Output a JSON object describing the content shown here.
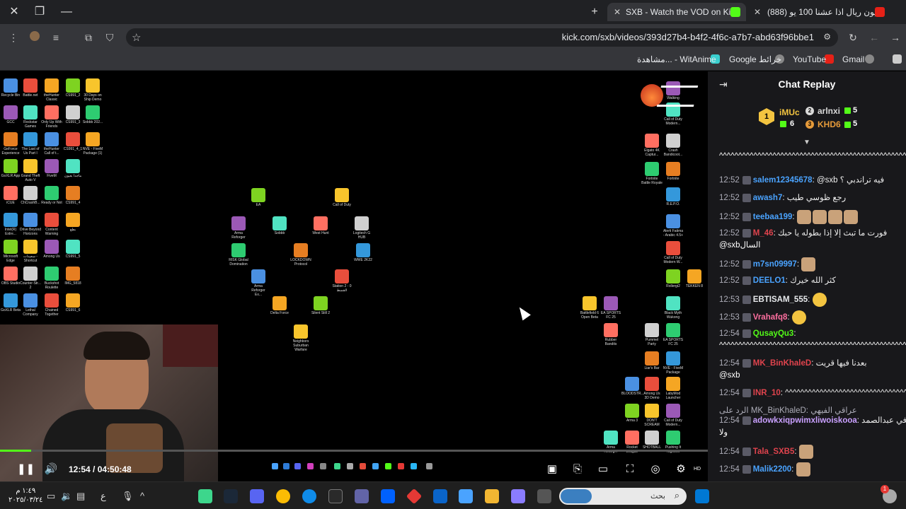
{
  "browser": {
    "tabs": [
      {
        "title": "SXB - Watch the VOD on Kick",
        "active": true
      },
      {
        "title": "(888) مليون ريال اذا عشنا 100 يو",
        "active": false
      }
    ],
    "url": "kick.com/sxb/videos/393d27b4-b4f2-4f6c-a7b7-abd63f96bbe1",
    "bookmarks": [
      {
        "label": "Gmail"
      },
      {
        "label": "YouTube"
      },
      {
        "label": "Google خرائط"
      },
      {
        "label": "مشاهدة... - WitAnime"
      }
    ]
  },
  "player": {
    "time_display": "12:54 / 04:50:48",
    "progress_fraction": 0.044
  },
  "desktop_icons": [
    {
      "label": "Recycle Bin"
    },
    {
      "label": "Battle.net"
    },
    {
      "label": "theHunter Classic"
    },
    {
      "label": "CS991_2"
    },
    {
      "label": "30 Days on Ship Demo"
    },
    {
      "label": "GCC"
    },
    {
      "label": "Rockstar Games"
    },
    {
      "label": "Only Up With Friends"
    },
    {
      "label": "CS991_3"
    },
    {
      "label": "Sobbb 202..."
    },
    {
      "label": "GeForce Experience"
    },
    {
      "label": "The Last of Us Part I"
    },
    {
      "label": "theHunter Call of t..."
    },
    {
      "label": "CS991_4_1"
    },
    {
      "label": "NVE - FiveM Package (1)"
    },
    {
      "label": "GoXLR App"
    },
    {
      "label": "Grand Theft Auto V"
    },
    {
      "label": "FiveM"
    },
    {
      "label": "ماجدا بعيون"
    },
    {
      "label": "iCUE"
    },
    {
      "label": "ChCrashB..."
    },
    {
      "label": "Ready or Not"
    },
    {
      "label": "CS991_4"
    },
    {
      "label": "Intel(R) Extre..."
    },
    {
      "label": "Drive Beyond Horizons"
    },
    {
      "label": "Content Warning"
    },
    {
      "label": "بطع"
    },
    {
      "label": "Microsoft Edge"
    },
    {
      "label": "سعيدات - Shortcut"
    },
    {
      "label": "Among Us"
    },
    {
      "label": "CS991_5"
    },
    {
      "label": "OBS Studio"
    },
    {
      "label": "Counter-Str... 2"
    },
    {
      "label": "Buckshot Roulette"
    },
    {
      "label": "IMG_5818"
    },
    {
      "label": "GoXLR Beta"
    },
    {
      "label": "Lethal Company"
    },
    {
      "label": "Chained Together"
    },
    {
      "label": "CS991_6"
    },
    {
      "label": "EA"
    },
    {
      "label": "Call of Duty"
    },
    {
      "label": "Arma Reforger"
    },
    {
      "label": "Sobbb"
    },
    {
      "label": "West Hunt"
    },
    {
      "label": "Logitech G HUB"
    },
    {
      "label": "RISK Global Domination"
    },
    {
      "label": "LOCKDOWN Protocol"
    },
    {
      "label": "WWE 2K22"
    },
    {
      "label": "Arma Reforger Ex..."
    },
    {
      "label": "Station 2 - 0 القسط"
    },
    {
      "label": "Delta Force"
    },
    {
      "label": "Silent Still 2"
    },
    {
      "label": "Neighbors Suburban Warfare"
    },
    {
      "label": "Walking"
    },
    {
      "label": "Call of Duty Modern..."
    },
    {
      "label": "Elgato 4K Captur..."
    },
    {
      "label": "Crash Bandicoot..."
    },
    {
      "label": "Fortnite Battle Royale"
    },
    {
      "label": "Fortnite"
    },
    {
      "label": "R.E.P.O."
    },
    {
      "label": "Alerti Fatima - Arabic 4.5+"
    },
    {
      "label": "Call of Duty Modern W..."
    },
    {
      "label": "TEKKEN 8"
    },
    {
      "label": "Rollergi2"
    },
    {
      "label": "Battlefield 6 Open Beta"
    },
    {
      "label": "EA SPORTS FC 25"
    },
    {
      "label": "Black Myth Wukong"
    },
    {
      "label": "Rubber Bandits"
    },
    {
      "label": "Pummel Party"
    },
    {
      "label": "EA SPORTS FC 25"
    },
    {
      "label": "Liar's Bar"
    },
    {
      "label": "NVE - FiveM Package"
    },
    {
      "label": "BLOODSTR..."
    },
    {
      "label": "Among Us 3D Demo"
    },
    {
      "label": "LabyMod Launcher"
    },
    {
      "label": "Arma 3"
    },
    {
      "label": "DON'T SCREAM"
    },
    {
      "label": "Call of Duty Modern..."
    },
    {
      "label": "Arma Reforg..."
    },
    {
      "label": "Rocket League"
    },
    {
      "label": "SHOTBALL"
    },
    {
      "label": "Pushing It Together"
    }
  ],
  "chat": {
    "title": "Chat Replay",
    "leaderboard": [
      {
        "rank": "1",
        "name": "iMUc",
        "count": "6",
        "color": "#f3c440"
      },
      {
        "rank": "2",
        "name": "arlnxi",
        "count": "5",
        "color": "#d9d9d9"
      },
      {
        "rank": "3",
        "name": "KHD6",
        "count": "5",
        "color": "#e59a3a"
      }
    ],
    "messages": [
      {
        "time": "",
        "user": "",
        "color": "#ffffff",
        "text": "^^^^^^^^^^^^^^^^^^^^^^^^^^^^^^^^^^^^^^^^^^^^^^^^^^^^^^^^^^^^"
      },
      {
        "time": "12:52",
        "user": "salem12345678",
        "color": "#4aa3ff",
        "text": "@sxb فيه تراندبي ؟"
      },
      {
        "time": "12:52",
        "user": "awash7",
        "color": "#4aa3ff",
        "text": "رجع ظوسي طيب"
      },
      {
        "time": "12:52",
        "user": "teebaa199",
        "color": "#4aa3ff",
        "text": ""
      },
      {
        "time": "12:52",
        "user": "M_46",
        "color": "#e0434d",
        "text": "فورت ما تبث إلا إذا بطوله يا حبك"
      },
      {
        "time": "",
        "user": "",
        "color": "#ffffff",
        "text": "@sxbالسال"
      },
      {
        "time": "12:52",
        "user": "m7sn09997",
        "color": "#4aa3ff",
        "text": ""
      },
      {
        "time": "12:52",
        "user": "DEELO1",
        "color": "#4aa3ff",
        "text": "كثر الله خيرك"
      },
      {
        "time": "12:53",
        "user": "EBTISAM_555",
        "color": "#e8eaed",
        "text": ""
      },
      {
        "time": "12:53",
        "user": "Vrahafq8",
        "color": "#ff6fa0",
        "text": ""
      },
      {
        "time": "12:54",
        "user": "QusayQu3",
        "color": "#53fc18",
        "text": ""
      },
      {
        "time": "",
        "user": "",
        "color": "#ffffff",
        "text": "^^^^^^^^^^^^^^^^^^^^^^^^^^^^^^^^^^^^^^^^^^^^^^^^^^^^^^^^^^^^"
      },
      {
        "time": "12:54",
        "user": "MK_BinKhaleD",
        "color": "#e0434d",
        "text": "بعدنا فيها قريت"
      },
      {
        "time": "",
        "user": "",
        "color": "#ffffff",
        "text": "@sxb"
      },
      {
        "time": "12:54",
        "user": "INR_10",
        "color": "#e0434d",
        "text": "^^^^^^^^^^^^^^^^^^^^^^^^^^^^^^^^^^^^"
      },
      {
        "time": "",
        "user": "",
        "color": "#adadb8",
        "text": "الرد على MK_BinKhaleD: عراقي الفيهي"
      },
      {
        "time": "12:54",
        "user": "adowkxiqpwimxliwoiskooa",
        "color": "#c9a0ff",
        "text": "في عبدالصمد"
      },
      {
        "time": "",
        "user": "",
        "color": "#ffffff",
        "text": "ولا"
      },
      {
        "time": "12:54",
        "user": "Tala_SXB5",
        "color": "#e0434d",
        "text": ""
      },
      {
        "time": "12:54",
        "user": "Malik2200",
        "color": "#4aa3ff",
        "text": ""
      }
    ]
  },
  "taskbar": {
    "search_placeholder": "بحث",
    "clock_time": "١:٤٩ م",
    "clock_date": "٢٠٢٥/٠٣/٢٤",
    "lang": "ع",
    "notification_count": "1"
  }
}
